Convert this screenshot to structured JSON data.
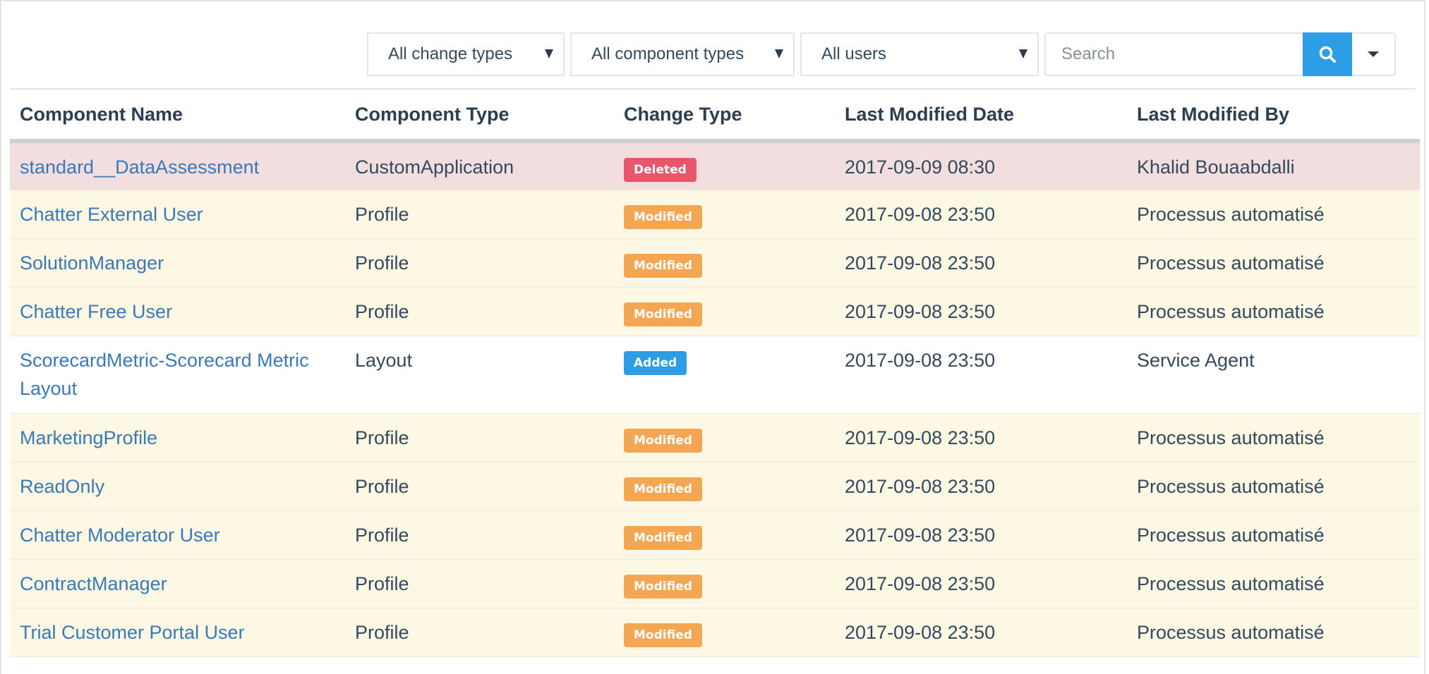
{
  "filters": {
    "change_types": "All change types",
    "component_types": "All component types",
    "users": "All users",
    "search_placeholder": "Search",
    "search_value": ""
  },
  "colors": {
    "accent": "#2d9ee6",
    "deleted": "#e9566a",
    "modified": "#f5a653",
    "added": "#2d9ee6",
    "link": "#3a78b8"
  },
  "table": {
    "headers": [
      "Component Name",
      "Component Type",
      "Change Type",
      "Last Modified Date",
      "Last Modified By"
    ],
    "rows": [
      {
        "name": "standard__DataAssessment",
        "type": "CustomApplication",
        "change": "Deleted",
        "date": "2017-09-09 08:30",
        "by": "Khalid Bouaabdalli"
      },
      {
        "name": "Chatter External User",
        "type": "Profile",
        "change": "Modified",
        "date": "2017-09-08 23:50",
        "by": "Processus automatisé"
      },
      {
        "name": "SolutionManager",
        "type": "Profile",
        "change": "Modified",
        "date": "2017-09-08 23:50",
        "by": "Processus automatisé"
      },
      {
        "name": "Chatter Free User",
        "type": "Profile",
        "change": "Modified",
        "date": "2017-09-08 23:50",
        "by": "Processus automatisé"
      },
      {
        "name": "ScorecardMetric-Scorecard Metric Layout",
        "type": "Layout",
        "change": "Added",
        "date": "2017-09-08 23:50",
        "by": "Service Agent"
      },
      {
        "name": "MarketingProfile",
        "type": "Profile",
        "change": "Modified",
        "date": "2017-09-08 23:50",
        "by": "Processus automatisé"
      },
      {
        "name": "ReadOnly",
        "type": "Profile",
        "change": "Modified",
        "date": "2017-09-08 23:50",
        "by": "Processus automatisé"
      },
      {
        "name": "Chatter Moderator User",
        "type": "Profile",
        "change": "Modified",
        "date": "2017-09-08 23:50",
        "by": "Processus automatisé"
      },
      {
        "name": "ContractManager",
        "type": "Profile",
        "change": "Modified",
        "date": "2017-09-08 23:50",
        "by": "Processus automatisé"
      },
      {
        "name": "Trial Customer Portal User",
        "type": "Profile",
        "change": "Modified",
        "date": "2017-09-08 23:50",
        "by": "Processus automatisé"
      }
    ]
  }
}
